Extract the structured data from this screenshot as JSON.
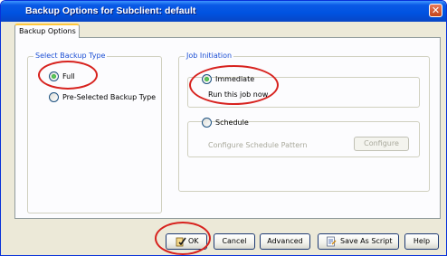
{
  "window": {
    "title": "Backup Options for Subclient: default",
    "close_glyph": "✕"
  },
  "tabs": [
    {
      "label": "Backup Options"
    }
  ],
  "backup_type": {
    "label": "Select Backup Type",
    "options": [
      {
        "label": "Full",
        "checked": true
      },
      {
        "label": "Pre-Selected Backup Type",
        "checked": false
      }
    ]
  },
  "job_initiation": {
    "label": "Job Initiation",
    "immediate": {
      "label": "Immediate",
      "checked": true,
      "description": "Run this job now"
    },
    "schedule": {
      "label": "Schedule",
      "checked": false,
      "pattern_label": "Configure Schedule Pattern",
      "configure_label": "Configure"
    }
  },
  "buttons": {
    "ok": "OK",
    "cancel": "Cancel",
    "advanced": "Advanced",
    "save_script": "Save As Script",
    "help": "Help"
  },
  "icons": {
    "ok": "ok-check-icon",
    "save_script": "script-icon",
    "close": "close-icon"
  },
  "colors": {
    "title_bar": "#0a5ae6",
    "group_label": "#1c4fd4",
    "annotation": "#d7221e",
    "window_bg": "#ece9d8"
  }
}
